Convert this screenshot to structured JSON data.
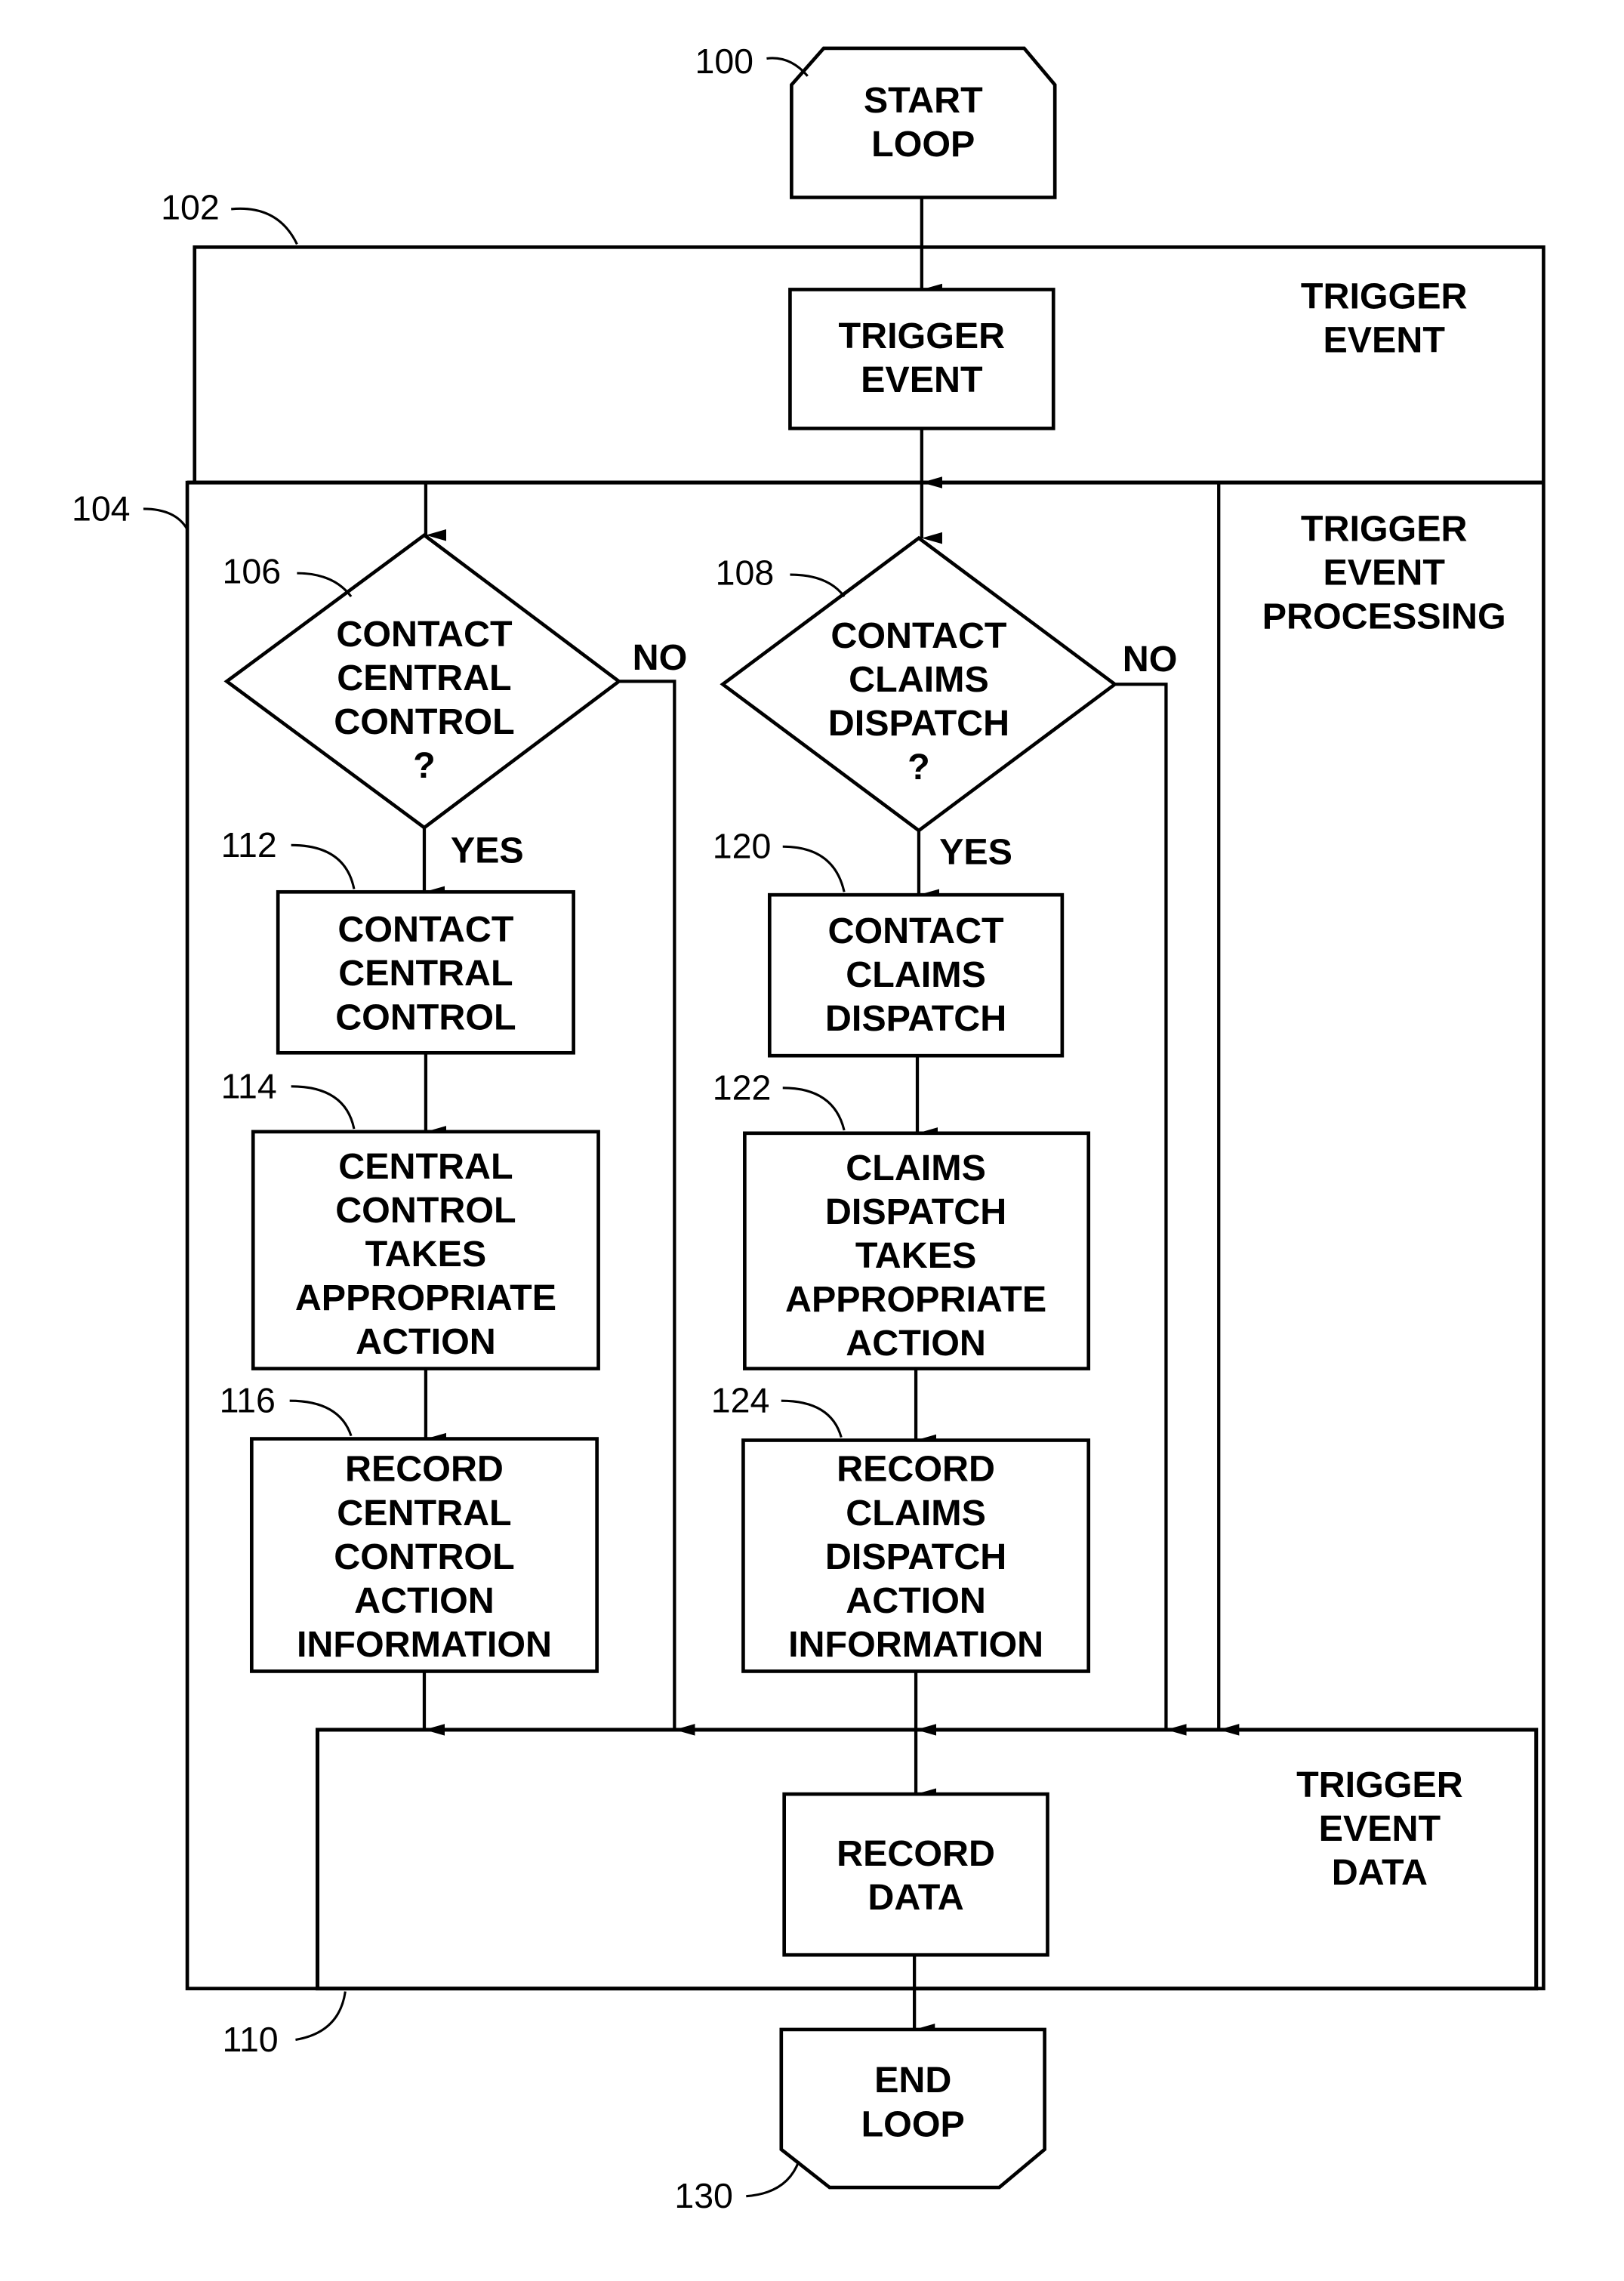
{
  "figure": {
    "start": {
      "ref": "100",
      "lines": [
        "START",
        "LOOP"
      ]
    },
    "end": {
      "ref": "130",
      "lines": [
        "END",
        "LOOP"
      ]
    },
    "sections": {
      "trigger_event": {
        "ref": "102",
        "lines": [
          "TRIGGER",
          "EVENT"
        ]
      },
      "processing": {
        "ref": "104",
        "lines": [
          "TRIGGER",
          "EVENT",
          "PROCESSING"
        ]
      },
      "data": {
        "ref": "110",
        "lines": [
          "TRIGGER",
          "EVENT",
          "DATA"
        ]
      }
    },
    "trigger_box": {
      "lines": [
        "TRIGGER",
        "EVENT"
      ]
    },
    "decisions": [
      {
        "ref": "106",
        "lines": [
          "CONTACT",
          "CENTRAL",
          "CONTROL",
          "?"
        ],
        "yes": "YES",
        "no": "NO"
      },
      {
        "ref": "108",
        "lines": [
          "CONTACT",
          "CLAIMS",
          "DISPATCH",
          "?"
        ],
        "yes": "YES",
        "no": "NO"
      }
    ],
    "left_steps": [
      {
        "ref": "112",
        "lines": [
          "CONTACT",
          "CENTRAL",
          "CONTROL"
        ]
      },
      {
        "ref": "114",
        "lines": [
          "CENTRAL",
          "CONTROL",
          "TAKES",
          "APPROPRIATE",
          "ACTION"
        ]
      },
      {
        "ref": "116",
        "lines": [
          "RECORD",
          "CENTRAL",
          "CONTROL",
          "ACTION",
          "INFORMATION"
        ]
      }
    ],
    "right_steps": [
      {
        "ref": "120",
        "lines": [
          "CONTACT",
          "CLAIMS",
          "DISPATCH"
        ]
      },
      {
        "ref": "122",
        "lines": [
          "CLAIMS",
          "DISPATCH",
          "TAKES",
          "APPROPRIATE",
          "ACTION"
        ]
      },
      {
        "ref": "124",
        "lines": [
          "RECORD",
          "CLAIMS",
          "DISPATCH",
          "ACTION",
          "INFORMATION"
        ]
      }
    ],
    "record_box": {
      "lines": [
        "RECORD",
        "DATA"
      ]
    }
  }
}
